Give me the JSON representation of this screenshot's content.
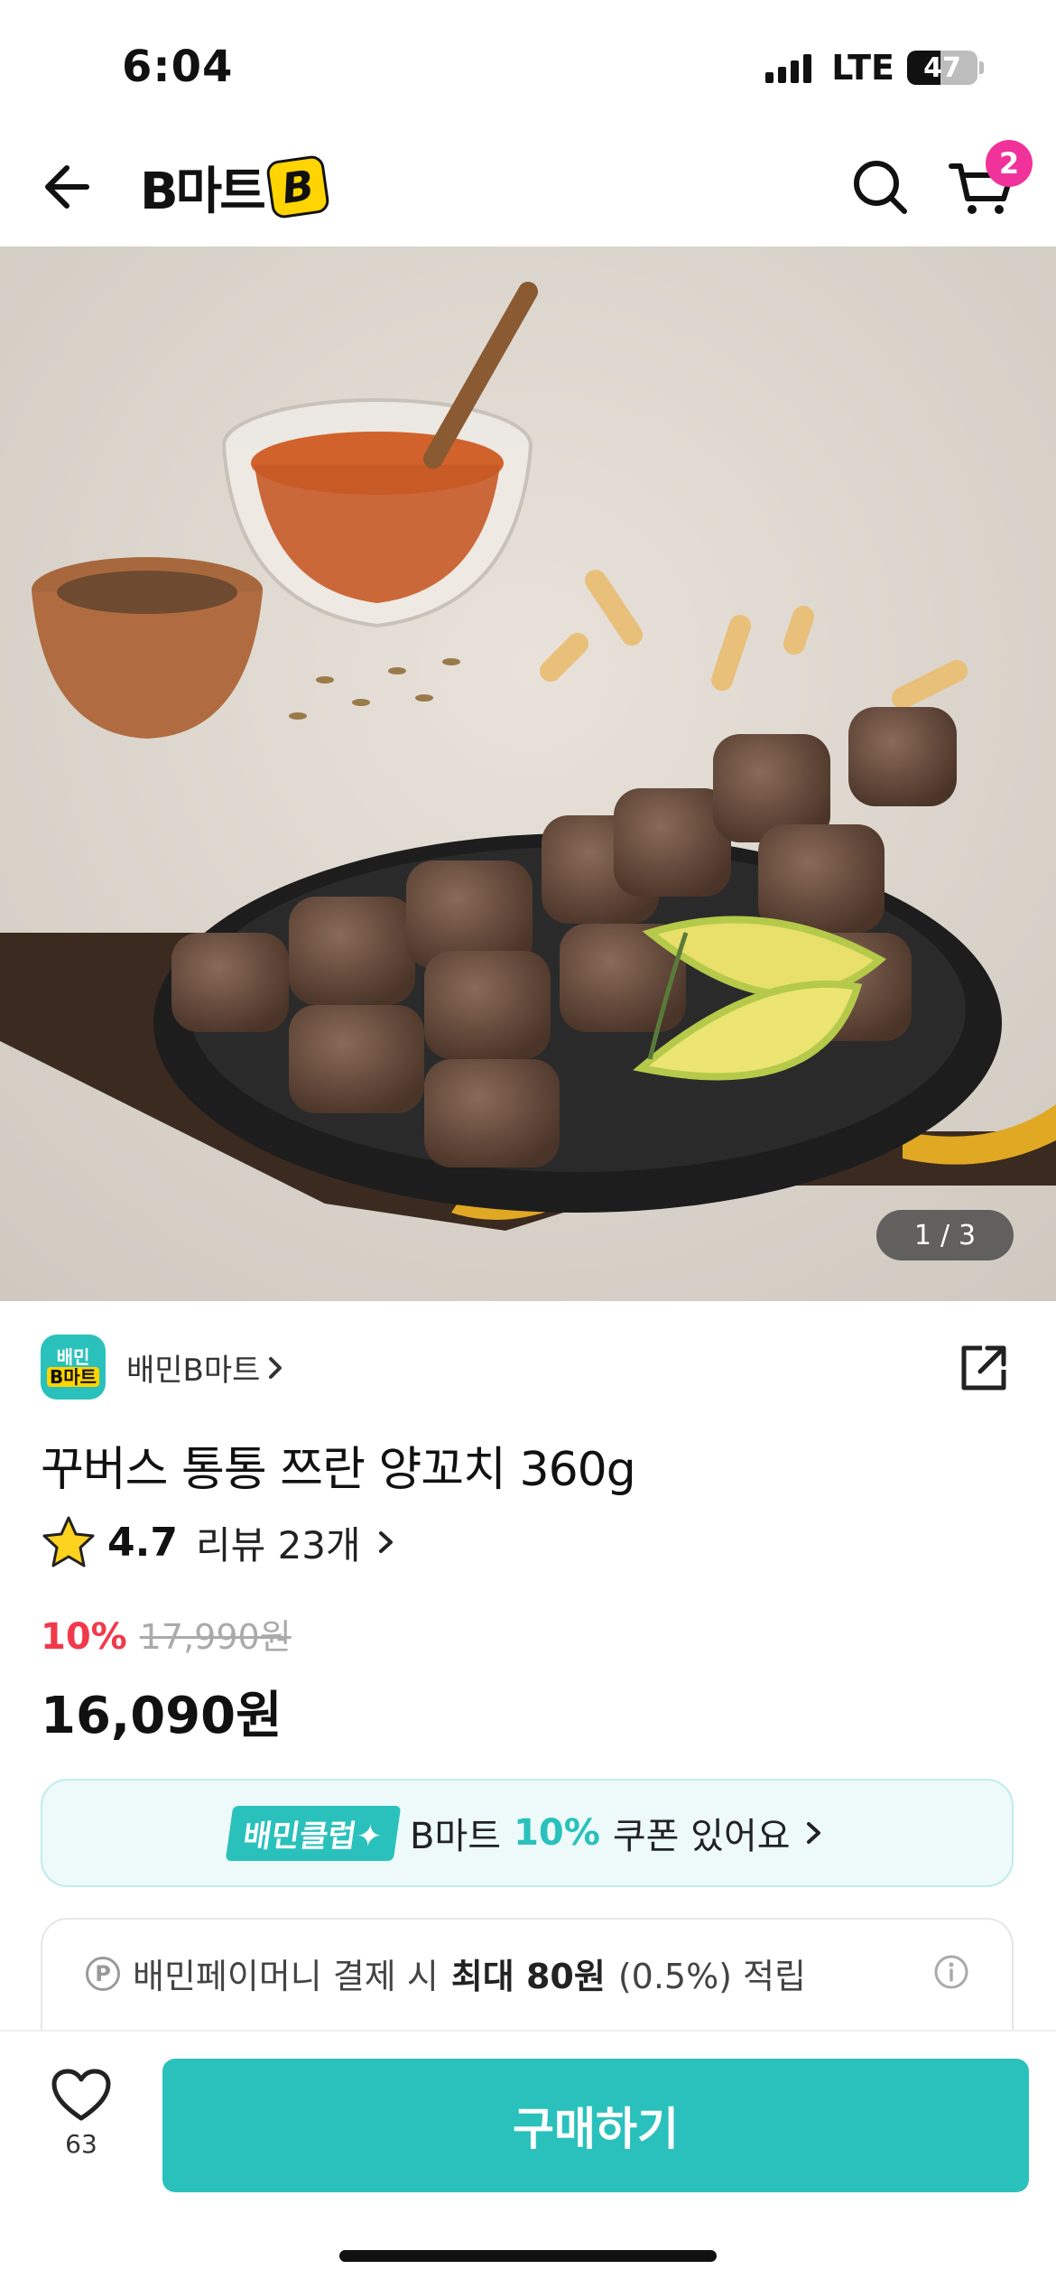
{
  "status_bar": {
    "time": "6:04",
    "network": "LTE",
    "battery": "47",
    "battery_level": 0.47
  },
  "header": {
    "back_icon": "arrow-left-icon",
    "logo_text": "B마트",
    "logo_mark": "B",
    "search_icon": "search-icon",
    "cart_icon": "cart-icon",
    "cart_count": "2"
  },
  "hero": {
    "image_description_icon": "product-photo",
    "counter_current": "1",
    "counter_sep": "/",
    "counter_total": "3"
  },
  "store": {
    "logo_line1": "배민",
    "logo_line2": "B마트",
    "name": "배민B마트",
    "chevron": "›",
    "share_icon": "share-icon"
  },
  "product": {
    "title": "꾸버스 통통 쯔란 양꼬치 360g",
    "rating": "4.7",
    "review_label": "리뷰 23개",
    "discount_rate": "10%",
    "original_price": "17,990원",
    "final_price": "16,090원"
  },
  "coupon": {
    "club_badge": "배민클럽✦",
    "text_before": "B마트",
    "percent": "10%",
    "text_after": "쿠폰 있어요",
    "chevron": "›"
  },
  "point": {
    "icon_letter": "P",
    "text_before": "배민페이머니 결제 시",
    "highlight": "최대 80원",
    "text_after": "(0.5%) 적립",
    "info_icon": "info-icon"
  },
  "bottom_bar": {
    "wish_icon": "heart-icon",
    "wish_count": "63",
    "buy_label": "구매하기"
  },
  "colors": {
    "mint": "#2ac1bc",
    "discount_red": "#f1394b",
    "badge_pink": "#f0329a",
    "coupon_bg": "#eefafa"
  }
}
